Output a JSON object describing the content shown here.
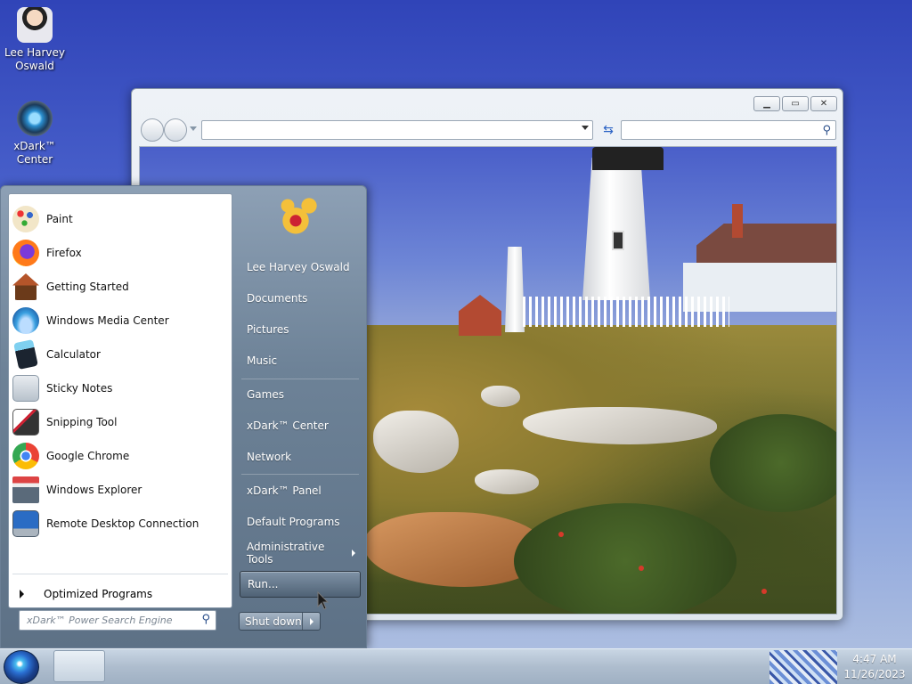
{
  "desktop": {
    "icons": [
      {
        "label_line1": "Lee Harvey",
        "label_line2": "Oswald"
      },
      {
        "label_line1": "xDark™",
        "label_line2": "Center"
      }
    ]
  },
  "explorer": {
    "address": "",
    "search_placeholder": ""
  },
  "start_menu": {
    "programs": [
      {
        "label": "Paint",
        "icon": "paint-icon"
      },
      {
        "label": "Firefox",
        "icon": "firefox-icon"
      },
      {
        "label": "Getting Started",
        "icon": "getting-started-icon"
      },
      {
        "label": "Windows Media Center",
        "icon": "media-center-icon"
      },
      {
        "label": "Calculator",
        "icon": "calculator-icon"
      },
      {
        "label": "Sticky Notes",
        "icon": "sticky-notes-icon"
      },
      {
        "label": "Snipping Tool",
        "icon": "snipping-tool-icon"
      },
      {
        "label": "Google Chrome",
        "icon": "chrome-icon"
      },
      {
        "label": "Windows Explorer",
        "icon": "explorer-icon"
      },
      {
        "label": "Remote Desktop Connection",
        "icon": "remote-desktop-icon"
      }
    ],
    "optimized_programs": "Optimized Programs",
    "search_placeholder": "xDark™ Power Search Engine",
    "right_items": [
      {
        "label": "Lee Harvey Oswald"
      },
      {
        "label": "Documents"
      },
      {
        "label": "Pictures"
      },
      {
        "label": "Music"
      },
      {
        "label": "Games"
      },
      {
        "label": "xDark™ Center"
      },
      {
        "label": "Network"
      },
      {
        "label": "xDark™ Panel"
      },
      {
        "label": "Default Programs"
      },
      {
        "label": "Administrative Tools"
      },
      {
        "label": "Run..."
      }
    ],
    "shutdown_label": "Shut down"
  },
  "taskbar": {
    "time": "4:47 AM",
    "date": "11/26/2023"
  }
}
